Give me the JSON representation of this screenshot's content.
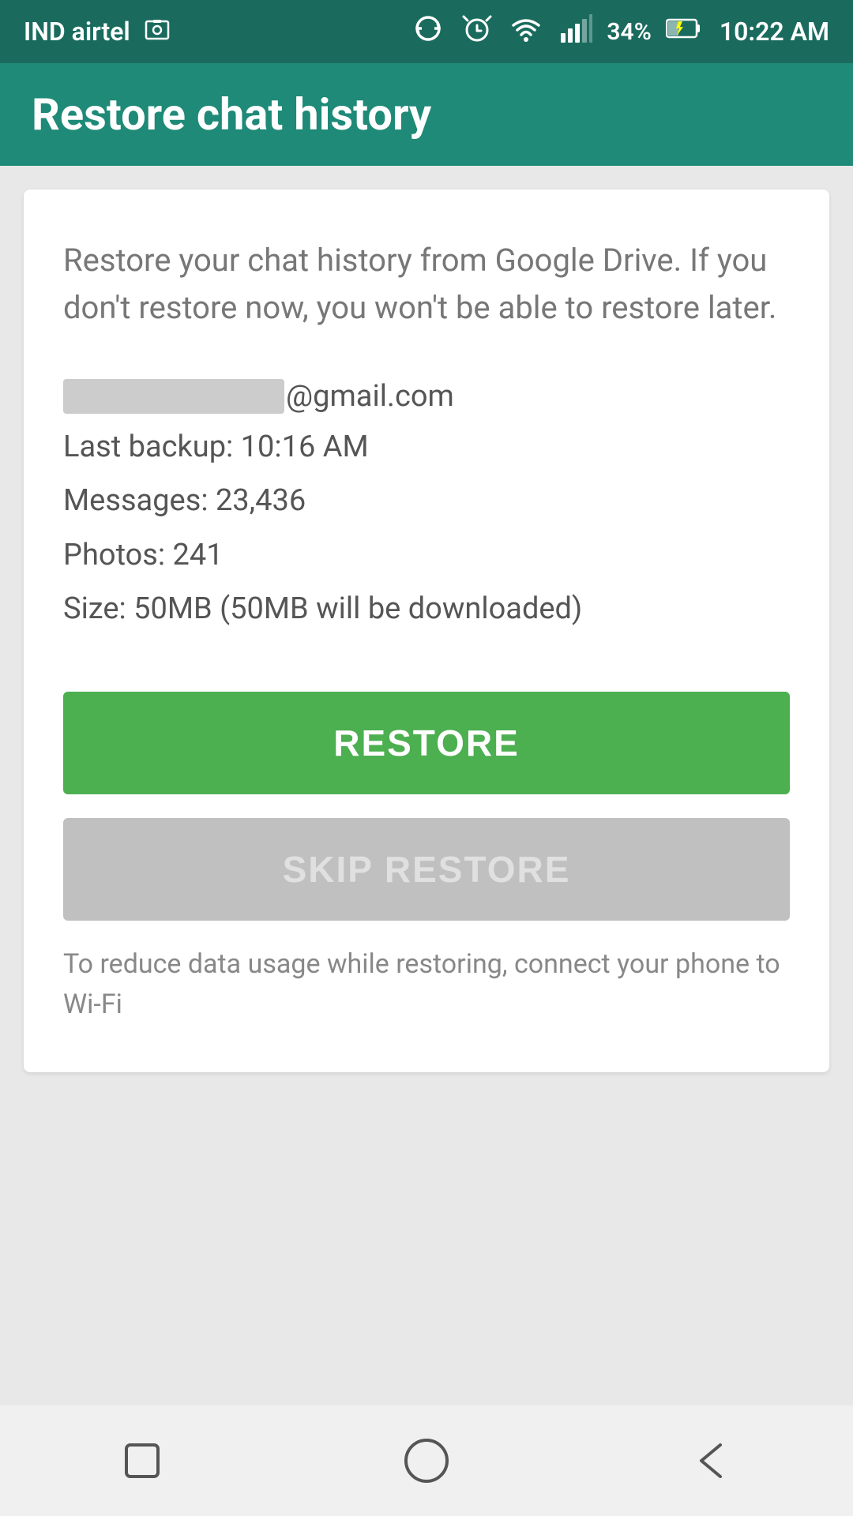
{
  "statusBar": {
    "carrier": "IND airtel",
    "screenshotIcon": "📷",
    "time": "10:22 AM",
    "battery": "34%",
    "batteryIcon": "🔋"
  },
  "toolbar": {
    "title": "Restore chat history"
  },
  "card": {
    "description": "Restore your chat history from Google Drive. If you don't restore now, you won't be able to restore later.",
    "emailBlurredPart": "██████████",
    "emailDomain": "@gmail.com",
    "lastBackup": "Last backup: 10:16 AM",
    "messages": "Messages: 23,436",
    "photos": "Photos: 241",
    "size": "Size: 50MB (50MB will be downloaded)",
    "restoreButton": "RESTORE",
    "skipButton": "SKIP RESTORE",
    "wifiNote": "To reduce data usage while restoring, connect your phone to Wi-Fi"
  },
  "navBar": {
    "recentIcon": "recent-apps-icon",
    "homeIcon": "home-icon",
    "backIcon": "back-icon"
  }
}
